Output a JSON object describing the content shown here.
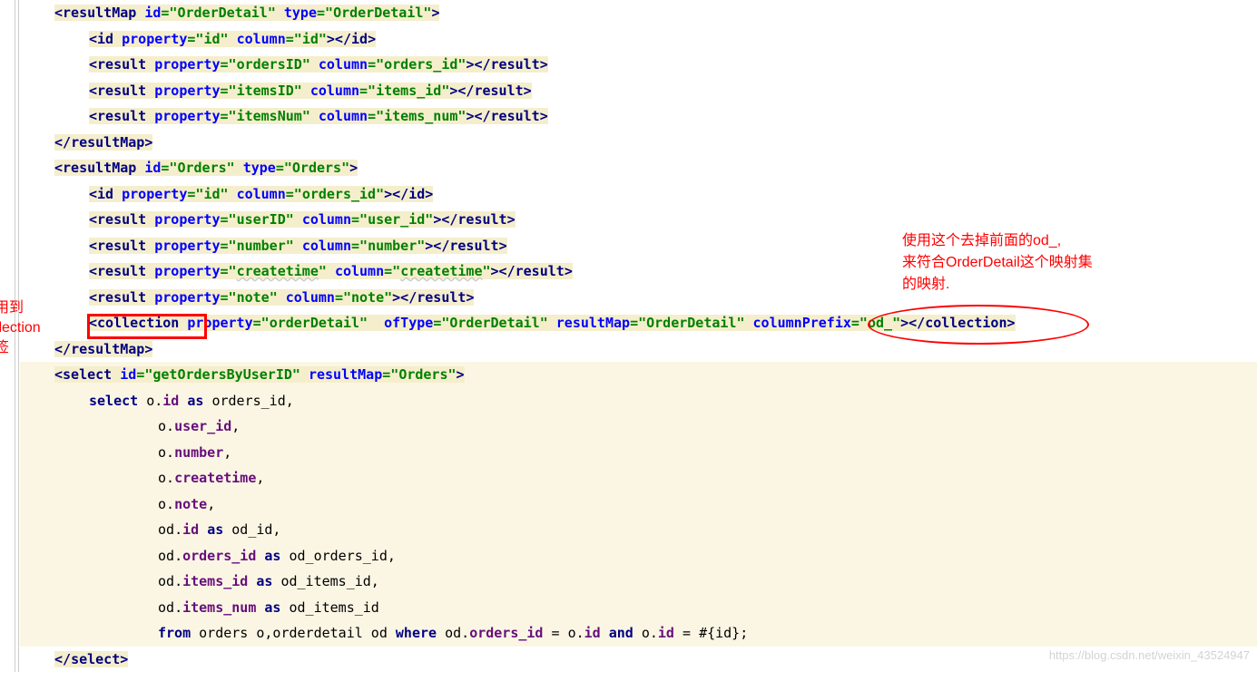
{
  "orderDetail": {
    "openTag": "resultMap",
    "idAttr": "id",
    "idVal": "OrderDetail",
    "typeAttr": "type",
    "typeVal": "OrderDetail",
    "lines": [
      {
        "elem": "id",
        "prop": "id",
        "col": "id"
      },
      {
        "elem": "result",
        "prop": "ordersID",
        "col": "orders_id"
      },
      {
        "elem": "result",
        "prop": "itemsID",
        "col": "items_id"
      },
      {
        "elem": "result",
        "prop": "itemsNum",
        "col": "items_num"
      }
    ]
  },
  "orders": {
    "openTag": "resultMap",
    "idAttr": "id",
    "idVal": "Orders",
    "typeAttr": "type",
    "typeVal": "Orders",
    "lines": [
      {
        "elem": "id",
        "prop": "id",
        "col": "orders_id"
      },
      {
        "elem": "result",
        "prop": "userID",
        "col": "user_id"
      },
      {
        "elem": "result",
        "prop": "number",
        "col": "number"
      },
      {
        "elem": "result",
        "prop": "createtime",
        "col": "createtime",
        "sp": true
      },
      {
        "elem": "result",
        "prop": "note",
        "col": "note"
      }
    ],
    "collection": {
      "elem": "collection",
      "propAttr": "property",
      "propVal": "orderDetail",
      "ofTypeAttr": "ofType",
      "ofTypeVal": "OrderDetail",
      "resultMapAttr": "resultMap",
      "resultMapVal": "OrderDetail",
      "colPrefixAttr": "columnPrefix",
      "colPrefixVal": "od_"
    }
  },
  "select": {
    "openTag": "select",
    "idAttr": "id",
    "idVal": "getOrdersByUserID",
    "resultMapAttr": "resultMap",
    "resultMapVal": "Orders",
    "sql": {
      "l1_select": "select",
      "l1_o": "o",
      "l1_id": "id",
      "l1_as": "as",
      "l1_alias": "orders_id,",
      "l2_o": "o",
      "l2_f": "user_id",
      "l2_c": ",",
      "l3_o": "o",
      "l3_f": "number",
      "l3_c": ",",
      "l4_o": "o",
      "l4_f": "createtime",
      "l4_c": ",",
      "l5_o": "o",
      "l5_f": "note",
      "l5_c": ",",
      "l6_o": "od",
      "l6_f": "id",
      "l6_as": "as",
      "l6_alias": "od_id,",
      "l7_o": "od",
      "l7_f": "orders_id",
      "l7_as": "as",
      "l7_alias": "od_orders_id,",
      "l8_o": "od",
      "l8_f": "items_id",
      "l8_as": "as",
      "l8_alias": "od_items_id,",
      "l9_o": "od",
      "l9_f": "items_num",
      "l9_as": "as",
      "l9_alias": "od_items_id",
      "l10_from": "from",
      "l10_tables": "orders o,orderdetail od",
      "l10_where": "where",
      "l10_od": "od",
      "l10_ordid": "orders_id",
      "l10_eq": "=",
      "l10_o": "o",
      "l10_id1": "id",
      "l10_and": "and",
      "l10_o2": "o",
      "l10_id2": "id",
      "l10_eq2": "=",
      "l10_param": "#{id};"
    }
  },
  "anno": {
    "left1": "使用到",
    "left2": "collection",
    "left3": "标签",
    "right1": "使用这个去掉前面的od_,",
    "right2": "来符合OrderDetail这个映射集",
    "right3": "的映射."
  },
  "watermark": "https://blog.csdn.net/weixin_43524947"
}
